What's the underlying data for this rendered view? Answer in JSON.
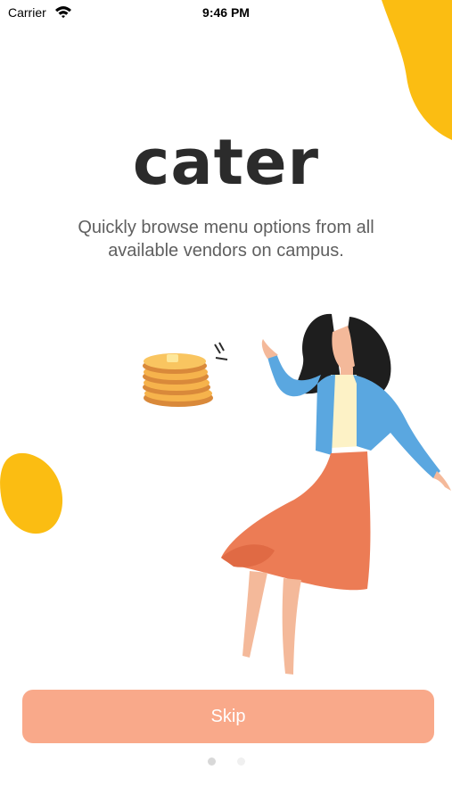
{
  "status_bar": {
    "carrier": "Carrier",
    "time": "9:46 PM",
    "wifi_icon": "wifi-icon",
    "battery_icon": "battery-charging-icon"
  },
  "app": {
    "logo_text": "cater",
    "tagline": "Quickly browse menu options from all available vendors on campus."
  },
  "illustration": {
    "name": "woman-pointing-at-pancakes-illustration"
  },
  "actions": {
    "skip_label": "Skip"
  },
  "pagination": {
    "total_pages": 2,
    "current_page": 1
  },
  "colors": {
    "accent_yellow": "#fbbd12",
    "skip_button": "#f9a98a",
    "logo": "#2b2b2b",
    "tagline": "#5f5f5f"
  }
}
